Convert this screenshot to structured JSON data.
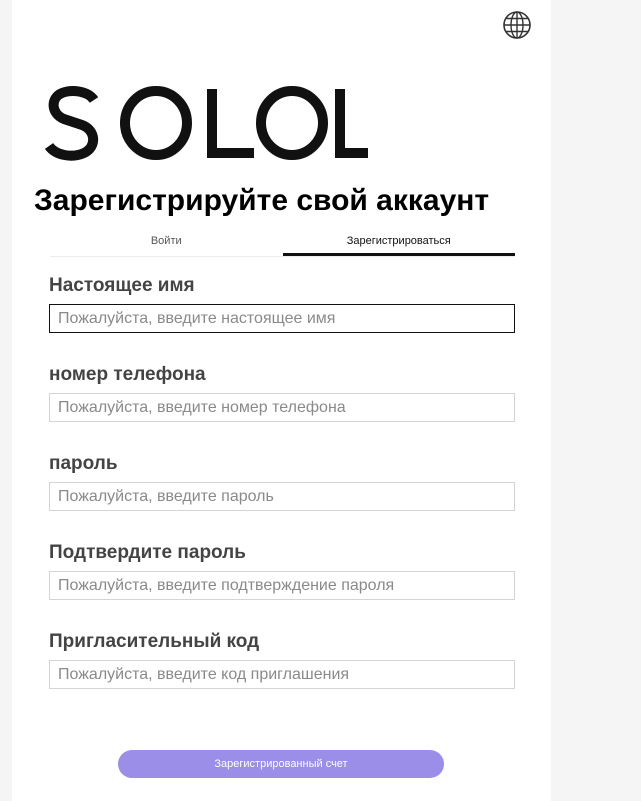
{
  "header": {
    "language_icon": "globe-icon",
    "logo_text": "SOLOL"
  },
  "page": {
    "title": "Зарегистрируйте свой аккаунт"
  },
  "tabs": [
    {
      "label": "Войти",
      "active": false
    },
    {
      "label": "Зарегистрироваться",
      "active": true
    }
  ],
  "form": {
    "fields": [
      {
        "label": "Настоящее имя",
        "placeholder": "Пожалуйста, введите настоящее имя",
        "focused": true
      },
      {
        "label": "номер телефона",
        "placeholder": "Пожалуйста, введите номер телефона"
      },
      {
        "label": "пароль",
        "placeholder": "Пожалуйста, введите пароль"
      },
      {
        "label": "Подтвердите пароль",
        "placeholder": "Пожалуйста, введите подтверждение пароля"
      },
      {
        "label": "Пригласительный код",
        "placeholder": "Пожалуйста, введите код приглашения"
      }
    ],
    "submit_label": "Зарегистрированный счет"
  },
  "colors": {
    "accent": "#9a8ee8",
    "active_tab": "#111111"
  }
}
